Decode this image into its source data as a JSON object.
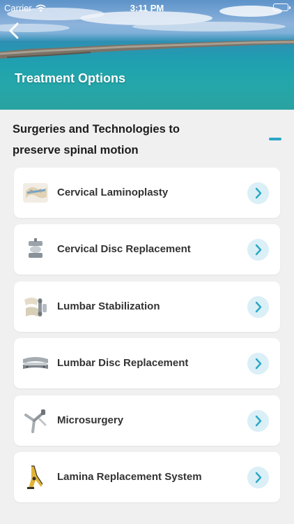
{
  "status_bar": {
    "carrier": "Carrier",
    "time": "3:11 PM"
  },
  "header": {
    "title": "Treatment Options",
    "back_icon": "chevron-left-icon"
  },
  "section": {
    "heading_line1": "Surgeries and Technologies to",
    "heading_line2": "preserve spinal motion",
    "collapse_icon": "minus-icon"
  },
  "accent_color": "#2aa7c6",
  "items": [
    {
      "label": "Cervical Laminoplasty",
      "icon": "cervical-laminoplasty-image"
    },
    {
      "label": "Cervical Disc Replacement",
      "icon": "cervical-disc-image"
    },
    {
      "label": "Lumbar Stabilization",
      "icon": "lumbar-stabilization-image"
    },
    {
      "label": "Lumbar Disc Replacement",
      "icon": "lumbar-disc-image"
    },
    {
      "label": "Microsurgery",
      "icon": "microsurgery-image"
    },
    {
      "label": "Lamina Replacement System",
      "icon": "lamina-replacement-image"
    }
  ]
}
